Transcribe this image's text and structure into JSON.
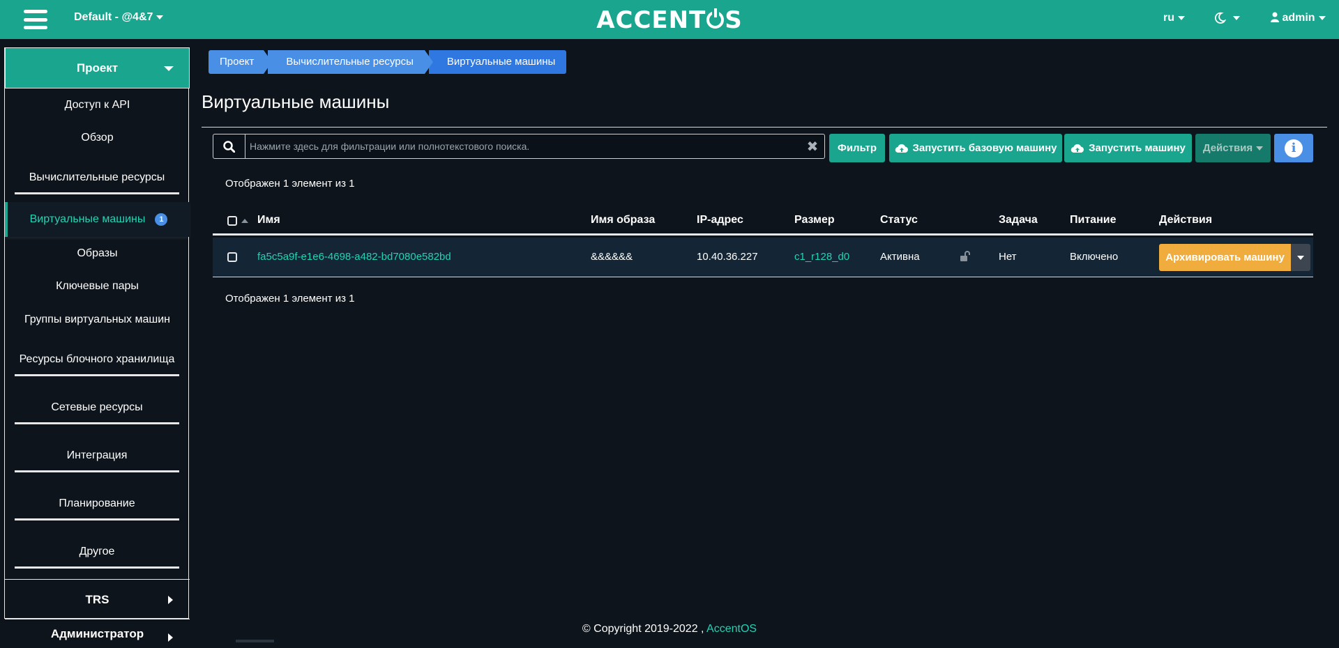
{
  "header": {
    "project_label": "Default - @4&7",
    "logo_left": "ACCENT",
    "logo_right": "S",
    "language": "ru",
    "user": "admin"
  },
  "sidebar": {
    "project": "Проект",
    "items": {
      "api": "Доступ к API",
      "overview": "Обзор",
      "compute": "Вычислительные ресурсы",
      "vms": "Виртуальные машины",
      "vms_badge": "1",
      "images": "Образы",
      "keypairs": "Ключевые пары",
      "server_groups": "Группы виртуальных машин",
      "block_storage": "Ресурсы блочного хранилища",
      "network": "Сетевые ресурсы",
      "integration": "Интеграция",
      "scheduling": "Планирование",
      "other": "Другое"
    },
    "trs": "TRS",
    "admin": "Администратор"
  },
  "breadcrumb": [
    "Проект",
    "Вычислительные ресурсы",
    "Виртуальные машины"
  ],
  "page_title": "Виртуальные машины",
  "toolbar": {
    "search_placeholder": "Нажмите здесь для фильтрации или полнотекстового поиска.",
    "filter": "Фильтр",
    "launch_base": "Запустить базовую машину",
    "launch": "Запустить машину",
    "actions": "Действия"
  },
  "count_text": "Отображен 1 элемент из 1",
  "table": {
    "headers": [
      "Имя",
      "Имя образа",
      "IP-адрес",
      "Размер",
      "Статус",
      "Задача",
      "Питание",
      "Действия"
    ],
    "rows": [
      {
        "name": "fa5c5a9f-e1e6-4698-a482-bd7080e582bd",
        "image": "&&&&&&",
        "ip": "10.40.36.227",
        "size": "c1_r128_d0",
        "status": "Активна",
        "task": "Нет",
        "power": "Включено",
        "action": "Архивировать машину"
      }
    ]
  },
  "footer": {
    "copyright": "© Copyright 2019-2022 ,",
    "brand": "AccentOS"
  },
  "colors": {
    "primary": "#1aa58e",
    "background": "#0d141c",
    "link": "#22d3b4",
    "info": "#4a8fe6",
    "warning": "#f0ad3e"
  }
}
